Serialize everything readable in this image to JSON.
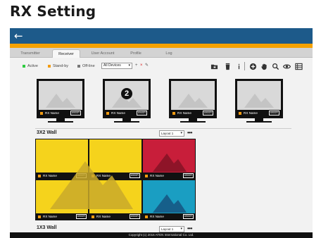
{
  "page": {
    "heading": "RX Setting"
  },
  "header": {
    "back_icon": "back-arrow-icon",
    "bar_color": "#1d5a8a",
    "accent_color": "#f5a200"
  },
  "tabs": [
    {
      "label": "Transmitter",
      "active": false
    },
    {
      "label": "Receiver",
      "active": true
    },
    {
      "label": "User Account",
      "active": false
    },
    {
      "label": "Profile",
      "active": false
    },
    {
      "label": "Log",
      "active": false
    }
  ],
  "legend": [
    {
      "label": "Active",
      "color": "#2ecc40"
    },
    {
      "label": "Stand-by",
      "color": "#f39c12"
    },
    {
      "label": "Off-line",
      "color": "#777777"
    }
  ],
  "filter": {
    "selected": "All Devices",
    "add": "+",
    "remove": "×",
    "edit": "✎"
  },
  "tools": [
    "folder-icon",
    "trash-icon",
    "info-icon",
    "add-circle-icon",
    "hand-icon",
    "search-icon",
    "eye-icon",
    "list-view-icon"
  ],
  "receivers": [
    {
      "name": "RX Name",
      "resolution": "6900R",
      "badge": ""
    },
    {
      "name": "RX Name",
      "resolution": "6940R",
      "badge": "2"
    },
    {
      "name": "RX Name",
      "resolution": "6900R",
      "badge": ""
    },
    {
      "name": "RX Name",
      "resolution": "6900R",
      "badge": ""
    }
  ],
  "walls": [
    {
      "title": "3X2 Wall",
      "layout": "Layout 1",
      "more": "•••",
      "cells": [
        {
          "name": "RX Name",
          "resolution": "6900R",
          "color": "#f5d31c",
          "mountain": "#d8b830"
        },
        {
          "name": "RX Name",
          "resolution": "6900R",
          "color": "#f5d31c",
          "mountain": "#d8b830"
        },
        {
          "name": "RX Name",
          "resolution": "6900R",
          "color": "#c81e3a",
          "mountain": "#8e1428"
        },
        {
          "name": "RX Name",
          "resolution": "6900R",
          "color": "#f5d31c",
          "mountain": "#d8b830"
        },
        {
          "name": "RX Name",
          "resolution": "6900R",
          "color": "#f5d31c",
          "mountain": "#d8b830"
        },
        {
          "name": "RX Name",
          "resolution": "6900R",
          "color": "#1a9ec2",
          "mountain": "#165f8a"
        }
      ]
    },
    {
      "title": "1X3 Wall",
      "layout": "Layout 1",
      "more": "•••"
    }
  ],
  "footer": {
    "copyright": "Copyright (c) 2016 ATEN International Co. Ltd."
  }
}
